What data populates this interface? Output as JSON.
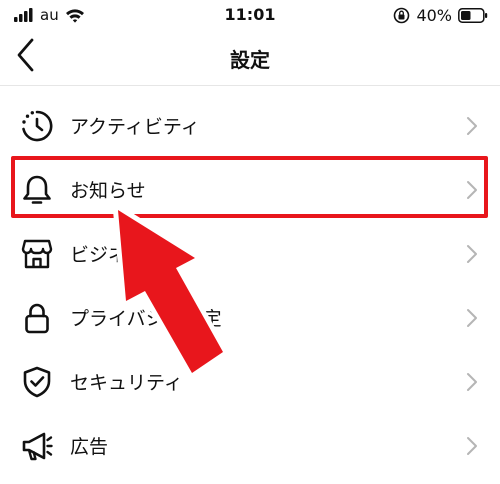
{
  "status_bar": {
    "carrier": "au",
    "time": "11:01",
    "battery": "40%"
  },
  "header": {
    "title": "設定"
  },
  "settings": {
    "items": [
      {
        "label": "アクティビティ",
        "icon": "activity-clock-icon"
      },
      {
        "label": "お知らせ",
        "icon": "bell-icon"
      },
      {
        "label": "ビジネス",
        "icon": "shop-icon"
      },
      {
        "label": "プライバシー設定",
        "icon": "lock-icon"
      },
      {
        "label": "セキュリティ",
        "icon": "shield-check-icon"
      },
      {
        "label": "広告",
        "icon": "megaphone-icon"
      }
    ]
  },
  "annotation": {
    "highlight_color": "#e8161c",
    "arrow_color": "#e8161c",
    "arrow_outline": "#ffffff"
  }
}
